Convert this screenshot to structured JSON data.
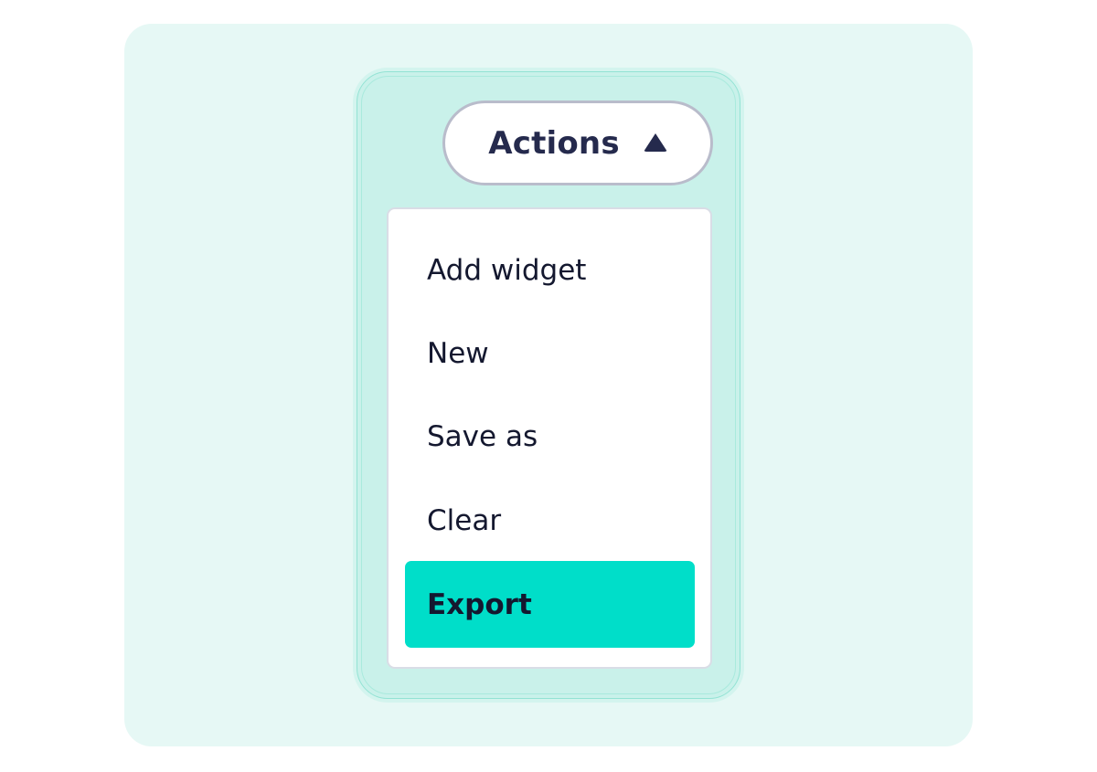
{
  "actions_button": {
    "label": "Actions",
    "icon": "triangle-up-icon",
    "expanded": true
  },
  "menu": {
    "items": [
      {
        "label": "Add widget",
        "highlighted": false
      },
      {
        "label": "New",
        "highlighted": false
      },
      {
        "label": "Save as",
        "highlighted": false
      },
      {
        "label": "Clear",
        "highlighted": false
      },
      {
        "label": "Export",
        "highlighted": true
      }
    ]
  },
  "colors": {
    "stage_background": "#e6f8f5",
    "menu_frame": "#c9f1ea",
    "highlight": "#00dec9",
    "text_dark": "#252a4d"
  }
}
